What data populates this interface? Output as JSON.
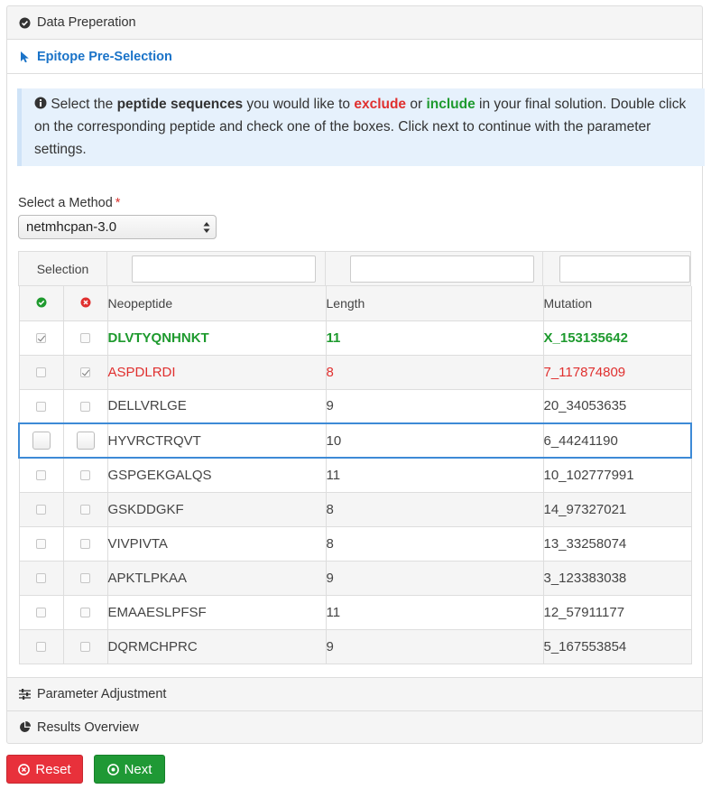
{
  "accordion": {
    "data_preparation": "Data Preperation",
    "epitope_preselection": "Epitope Pre-Selection",
    "parameter_adjustment": "Parameter Adjustment",
    "results_overview": "Results Overview"
  },
  "info": {
    "t1": "Select the ",
    "t2": "peptide sequences",
    "t3": " you would like to ",
    "t4": "exclude",
    "t5": " or ",
    "t6": "include",
    "t7": " in your final solution. Double click on the corresponding peptide and check one of the boxes. Click next to continue with the parameter settings."
  },
  "method": {
    "label": "Select a Method",
    "required_mark": "*",
    "selected": "netmhcpan-3.0"
  },
  "table": {
    "selection_header": "Selection",
    "columns": [
      "Neopeptide",
      "Length",
      "Mutation"
    ],
    "rows": [
      {
        "peptide": "DLVTYQNHNKT",
        "length": "11",
        "mutation": "X_153135642"
      },
      {
        "peptide": "ASPDLRDI",
        "length": "8",
        "mutation": "7_117874809"
      },
      {
        "peptide": "DELLVRLGE",
        "length": "9",
        "mutation": "20_34053635"
      },
      {
        "peptide": "HYVRCTRQVT",
        "length": "10",
        "mutation": "6_44241190"
      },
      {
        "peptide": "GSPGEKGALQS",
        "length": "11",
        "mutation": "10_102777991"
      },
      {
        "peptide": "GSKDDGKF",
        "length": "8",
        "mutation": "14_97327021"
      },
      {
        "peptide": "VIVPIVTA",
        "length": "8",
        "mutation": "13_33258074"
      },
      {
        "peptide": "APKTLPKAA",
        "length": "9",
        "mutation": "3_123383038"
      },
      {
        "peptide": "EMAAESLPFSF",
        "length": "11",
        "mutation": "12_57911177"
      },
      {
        "peptide": "DQRMCHPRC",
        "length": "9",
        "mutation": "5_167553854"
      }
    ]
  },
  "buttons": {
    "reset": "Reset",
    "next": "Next"
  },
  "colors": {
    "include": "#1e9a2e",
    "exclude": "#e0302f",
    "active_link": "#1a73c8"
  }
}
